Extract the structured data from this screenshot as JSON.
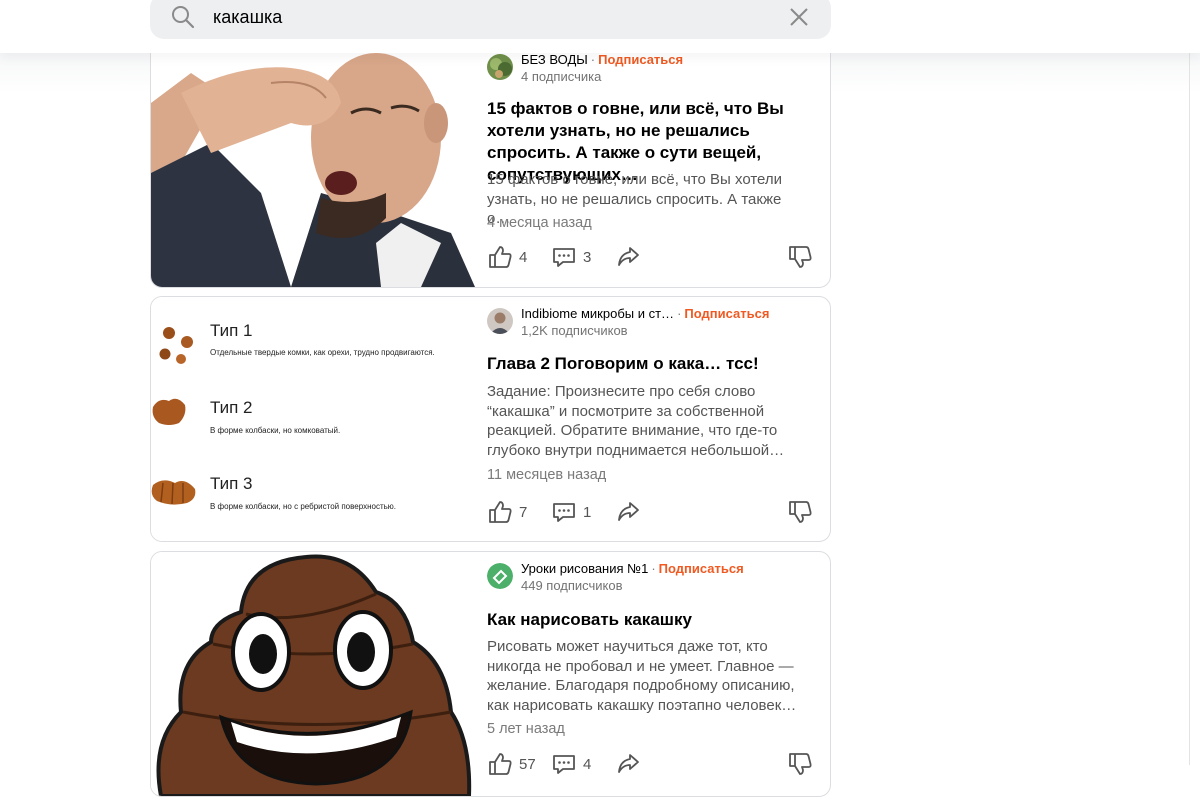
{
  "search": {
    "query": "какашка"
  },
  "articles": [
    {
      "channel": "БЕЗ ВОДЫ",
      "subscribe_label": "Подписаться",
      "subscribers": "4 подписчика",
      "title": "15 фактов о говне, или всё, что Вы хотели узнать, но не решались спросить. А также о сути вещей, сопутствующих…",
      "snippet": "15 фактов о говне, или всё, что Вы хотели узнать, но не решались спросить. А также о…",
      "date": "4 месяца назад",
      "likes": "4",
      "comments": "3"
    },
    {
      "channel": "Indibiome микробы и ст…",
      "subscribe_label": "Подписаться",
      "subscribers": "1,2K подписчиков",
      "title": "Глава 2 Поговорим о кака… тсс!",
      "snippet": "Задание: Произнесите про себя слово “какашка” и посмотрите за собственной реакцией. Обратите внимание, что где-то глубоко внутри поднимается небольшой…",
      "date": "11 месяцев назад",
      "likes": "7",
      "comments": "1",
      "thumb": [
        {
          "name": "Тип 1",
          "desc": "Отдельные твердые комки, как орехи, трудно продвигаются."
        },
        {
          "name": "Тип 2",
          "desc": "В форме колбаски, но комковатый."
        },
        {
          "name": "Тип 3",
          "desc": "В форме колбаски, но с ребристой поверхностью."
        }
      ]
    },
    {
      "channel": "Уроки рисования №1",
      "subscribe_label": "Подписаться",
      "subscribers": "449 подписчиков",
      "title": "Как нарисовать какашку",
      "snippet": "Рисовать может научиться даже тот, кто никогда не пробовал и не умеет. Главное — желание. Благодаря подробному описанию, как нарисовать какашку поэтапно человек…",
      "date": "5 лет назад",
      "likes": "57",
      "comments": "4"
    }
  ],
  "colors": {
    "accent": "#f05a22",
    "search_bg": "#eeeff1"
  },
  "icons": [
    "search-icon",
    "close-icon",
    "like-icon",
    "comment-icon",
    "share-icon",
    "dislike-icon"
  ]
}
